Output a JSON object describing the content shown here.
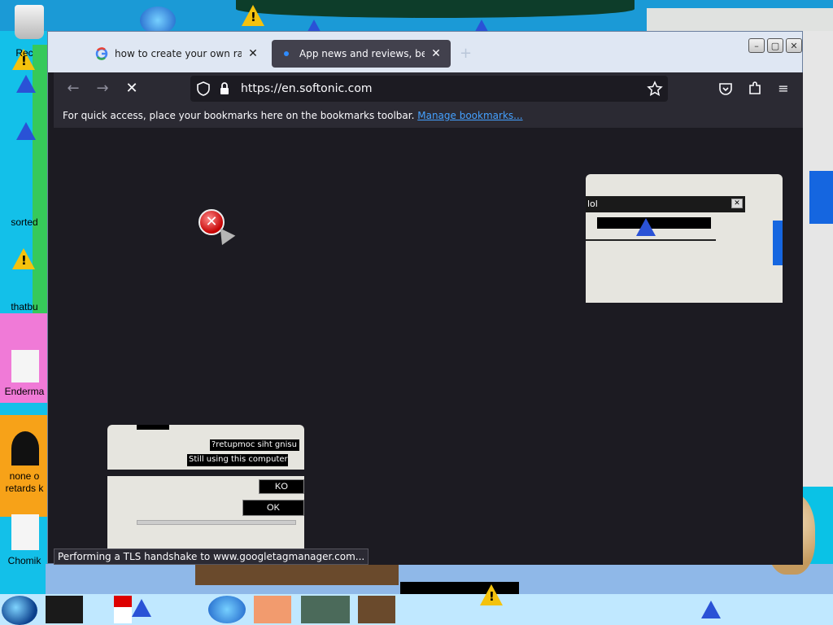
{
  "desktop": {
    "icons": [
      {
        "label": "Rec"
      },
      {
        "label": "sorted"
      },
      {
        "label": "thatbu"
      },
      {
        "label": "Enderma"
      },
      {
        "label": "none o"
      },
      {
        "label": "retards k"
      },
      {
        "label": "Chomik"
      }
    ]
  },
  "browser": {
    "tabs": [
      {
        "label": "how to create your own ransomware",
        "favicon": "google-icon",
        "close": "✕"
      },
      {
        "label": "App news and reviews, best software",
        "favicon": "softonic-icon",
        "close": "✕"
      }
    ],
    "new_tab": "+",
    "url": "https://en.softonic.com",
    "bookmarks_hint": "For quick access, place your bookmarks here on the bookmarks toolbar.",
    "bookmarks_link": "Manage bookmarks...",
    "status": "Performing a TLS handshake to www.googletagmanager.com..."
  },
  "dialogs": {
    "upper": {
      "title": "lol"
    },
    "lower": {
      "mirrored": "?retupmoc siht gnisu llitS",
      "message": "Still using this computer?",
      "ok_mirrored": "KO",
      "ok": "OK"
    }
  },
  "colors": {
    "accent_link": "#45a1ff",
    "window_bg": "#1c1b22",
    "toolbar_bg": "#2b2a33",
    "titlebar_bg": "#dfe7f3"
  }
}
